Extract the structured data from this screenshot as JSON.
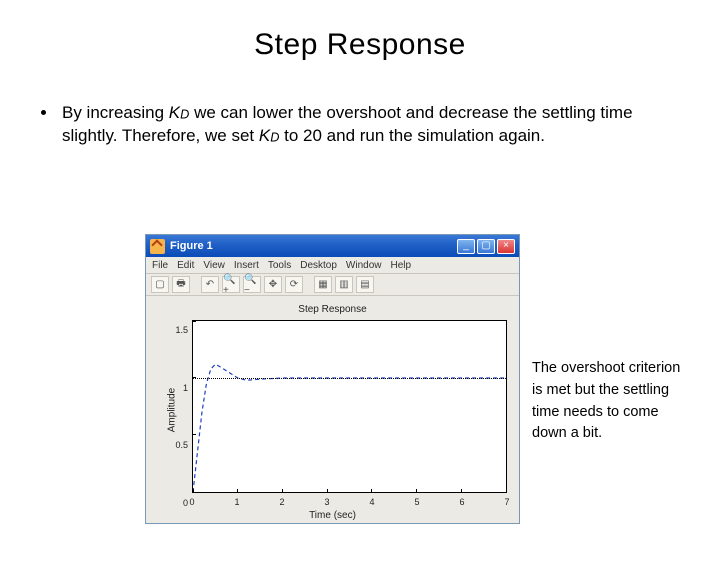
{
  "slide": {
    "title": "Step Response",
    "bullet_prefix": "By increasing ",
    "bullet_kd1": "K",
    "bullet_kd1_sub": "D",
    "bullet_mid": " we can lower the overshoot and decrease the settling time slightly. Therefore, we set ",
    "bullet_kd2": "K",
    "bullet_kd2_sub": "D",
    "bullet_suffix": " to 20 and run the simulation again.",
    "caption": "The overshoot criterion is met but the settling time needs to come down a bit."
  },
  "figwin": {
    "title": "Figure 1",
    "min": "_",
    "max": "▢",
    "close": "×",
    "menu": [
      "File",
      "Edit",
      "View",
      "Insert",
      "Tools",
      "Desktop",
      "Window",
      "Help"
    ],
    "tools": [
      "▢",
      "🖶",
      "",
      "↶",
      "🔍+",
      "🔍−",
      "✥",
      "⟳",
      "",
      "▦",
      "▥",
      "▤"
    ]
  },
  "chart_data": {
    "type": "line",
    "title": "Step Response",
    "xlabel": "Time (sec)",
    "ylabel": "Amplitude",
    "xlim": [
      0,
      7
    ],
    "ylim": [
      0,
      1.5
    ],
    "xticks": [
      0,
      1,
      2,
      3,
      4,
      5,
      6,
      7
    ],
    "yticks": [
      0,
      0.5,
      1,
      1.5
    ],
    "ytick_labels": [
      "0",
      "0.5",
      "1",
      "1.5"
    ],
    "reference": 1.0,
    "series": [
      {
        "name": "response",
        "style": "dashed",
        "color": "#1f3fbf",
        "x": [
          0,
          0.1,
          0.2,
          0.3,
          0.4,
          0.5,
          0.6,
          0.8,
          1.0,
          1.2,
          1.5,
          2.0,
          2.5,
          3.0,
          3.5,
          4.0,
          4.5,
          5.0,
          5.5,
          6.0,
          6.5,
          7.0
        ],
        "y": [
          0,
          0.35,
          0.7,
          0.95,
          1.08,
          1.12,
          1.1,
          1.05,
          1.0,
          0.98,
          0.99,
          1.0,
          1.0,
          1.0,
          1.0,
          1.0,
          1.0,
          1.0,
          1.0,
          1.0,
          1.0,
          1.0
        ]
      }
    ]
  }
}
